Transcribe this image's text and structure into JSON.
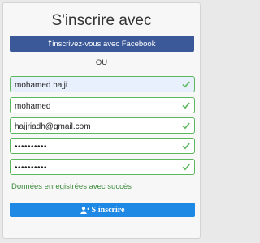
{
  "form": {
    "title": "S'inscrire avec",
    "facebook_button": {
      "icon": "facebook-f-icon",
      "label": "inscrivez-vous avec Facebook",
      "color": "#3b5998"
    },
    "separator": "OU",
    "fields": {
      "full_name": "mohamed hajji",
      "username": "mohamed",
      "email": "hajjriadh@gmail.com",
      "password": "••••••••••",
      "confirm_password": "••••••••••"
    },
    "valid_color": "#5cb85c",
    "success_message": "Données enregistrées avec succès",
    "submit_button": {
      "icon": "user-plus-icon",
      "label": "S'inscrire",
      "color": "#1e88e5"
    }
  }
}
